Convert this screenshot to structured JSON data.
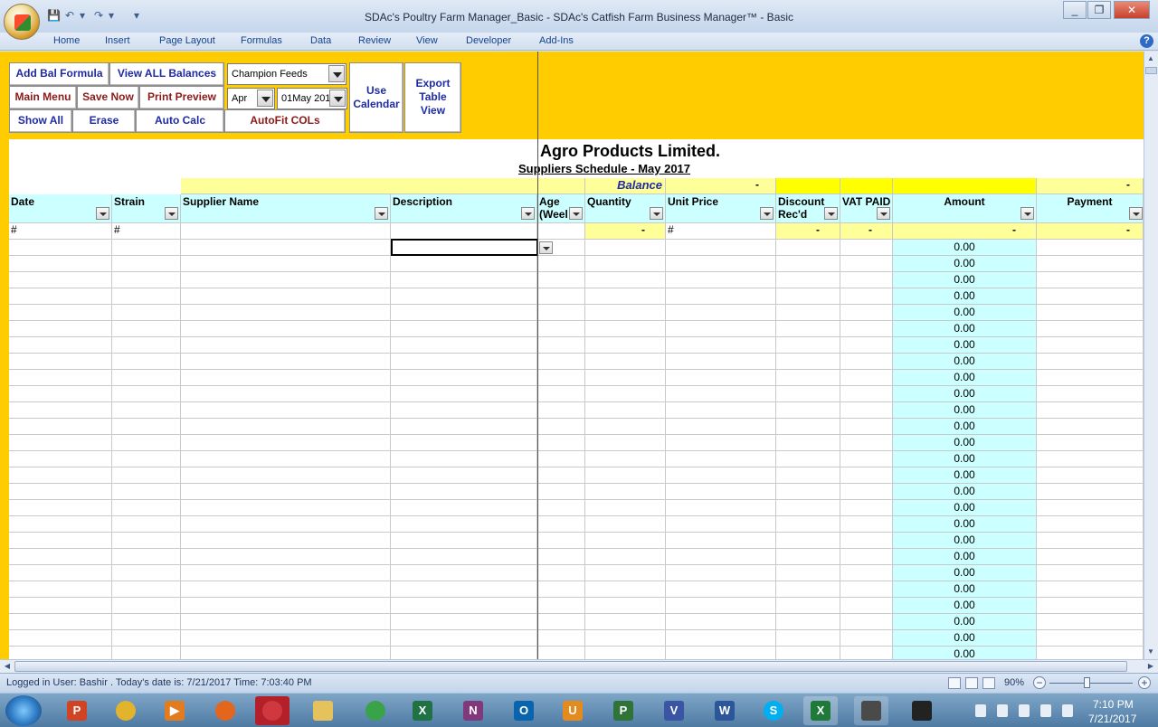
{
  "window": {
    "title": "SDAc's Poultry Farm Manager_Basic - SDAc's Catfish Farm Business Manager™ - Basic",
    "minimize": "_",
    "restore": "❐",
    "close": "✕"
  },
  "ribbon": {
    "tabs": [
      "Home",
      "Insert",
      "Page Layout",
      "Formulas",
      "Data",
      "Review",
      "View",
      "Developer",
      "Add-Ins"
    ],
    "help": "?"
  },
  "controls": {
    "add_bal_formula": "Add Bal Formula",
    "view_all_balances": "View ALL Balances",
    "main_menu": "Main Menu",
    "save_now": "Save Now",
    "print_preview": "Print Preview",
    "show_all": "Show All",
    "erase": "Erase",
    "auto_calc": "Auto Calc",
    "autofit_cols": "AutoFit COLs",
    "use_calendar": [
      "Use",
      "Calendar"
    ],
    "export_table_view": [
      "Export",
      "Table",
      "View"
    ],
    "supplier_combo": "Champion Feeds",
    "month_combo": "Apr",
    "date_combo": "01May 201"
  },
  "sheet": {
    "company_title": "Agro Products Limited.",
    "schedule_title": "Suppliers Schedule - May 2017",
    "balance_label": "Balance",
    "dash": "-",
    "columns": {
      "date": "Date",
      "strain": "Strain",
      "supplier_name": "Supplier Name",
      "description": "Description",
      "age": [
        "Age",
        "(Weel"
      ],
      "quantity": "Quantity",
      "unit_price": "Unit Price",
      "discount": [
        "Discount",
        "Rec'd"
      ],
      "vat_paid": "VAT PAID",
      "amount": "Amount",
      "payment": "Payment"
    },
    "total_row": {
      "date": "#",
      "strain": "#",
      "quantity": "-",
      "unit_price": "#",
      "discount": "-",
      "vat_paid": "-",
      "amount": "-",
      "payment": "-"
    },
    "amount_values": [
      "0.00",
      "0.00",
      "0.00",
      "0.00",
      "0.00",
      "0.00",
      "0.00",
      "0.00",
      "0.00",
      "0.00",
      "0.00",
      "0.00",
      "0.00",
      "0.00",
      "0.00",
      "0.00",
      "0.00",
      "0.00",
      "0.00",
      "0.00",
      "0.00",
      "0.00",
      "0.00",
      "0.00",
      "0.00",
      "0.00"
    ]
  },
  "status": {
    "text": "Logged in User: Bashir .          Today's date is: 7/21/2017 Time: 7:03:40 PM",
    "zoom": "90%",
    "zoom_minus": "−",
    "zoom_plus": "+"
  },
  "taskbar": {
    "time": "7:10 PM",
    "date": "7/21/2017"
  }
}
